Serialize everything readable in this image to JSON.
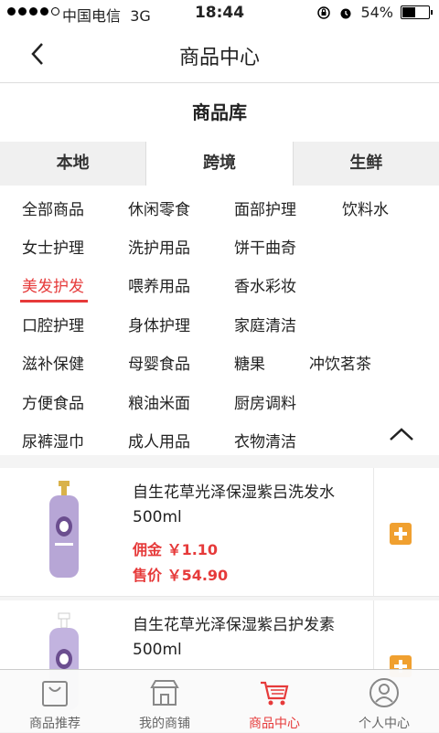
{
  "status_bar": {
    "carrier": "中国电信",
    "network": "3G",
    "time": "18:44",
    "battery": "54%",
    "battery_level": 0.54
  },
  "nav": {
    "title": "商品中心"
  },
  "section": {
    "title": "商品库"
  },
  "tabs": [
    {
      "label": "本地"
    },
    {
      "label": "跨境"
    },
    {
      "label": "生鲜"
    }
  ],
  "active_tab": "跨境",
  "categories": [
    [
      "全部商品",
      "休闲零食",
      "面部护理",
      "饮料水"
    ],
    [
      "女士护理",
      "洗护用品",
      "饼干曲奇"
    ],
    [
      "美发护发",
      "喂养用品",
      "香水彩妆"
    ],
    [
      "口腔护理",
      "身体护理",
      "家庭清洁"
    ],
    [
      "滋补保健",
      "母婴食品",
      "糖果",
      "冲饮茗茶"
    ],
    [
      "方便食品",
      "粮油米面",
      "厨房调料"
    ],
    [
      "尿裤湿巾",
      "成人用品",
      "衣物清洁"
    ]
  ],
  "active_category": "美发护发",
  "products": [
    {
      "name": "自生花草光泽保湿紫吕洗发水500ml",
      "commission": "佣金 ￥1.10",
      "price": "售价 ￥54.90"
    },
    {
      "name": "自生花草光泽保湿紫吕护发素500ml",
      "commission": "",
      "price": ""
    }
  ],
  "tabbar": [
    {
      "label": "商品推荐",
      "icon": "bag-icon"
    },
    {
      "label": "我的商铺",
      "icon": "store-icon"
    },
    {
      "label": "商品中心",
      "icon": "cart-icon"
    },
    {
      "label": "个人中心",
      "icon": "user-icon"
    }
  ],
  "colors": {
    "accent": "#e63a3a",
    "add_button": "#f0a030"
  }
}
